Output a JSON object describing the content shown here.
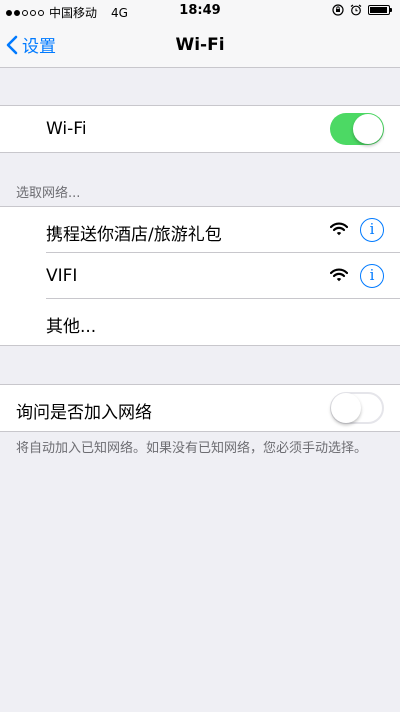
{
  "status_bar": {
    "carrier": "中国移动",
    "network": "4G",
    "time": "18:49"
  },
  "nav": {
    "back_label": "设置",
    "title": "Wi-Fi"
  },
  "wifi_toggle": {
    "label": "Wi-Fi",
    "on": true
  },
  "networks": {
    "header": "选取网络...",
    "items": [
      {
        "name": "携程送你酒店/旅游礼包"
      },
      {
        "name": "VIFI"
      }
    ],
    "other_label": "其他..."
  },
  "ask_to_join": {
    "label": "询问是否加入网络",
    "on": false,
    "note": "将自动加入已知网络。如果没有已知网络，您必须手动选择。"
  },
  "icons": {
    "back": "chevron-left-icon",
    "wifi": "wifi-signal-icon",
    "info": "info-icon",
    "orientation_lock": "orientation-lock-icon",
    "alarm": "alarm-icon",
    "battery": "battery-icon"
  },
  "colors": {
    "accent": "#007aff",
    "toggle_on": "#4cd964",
    "background": "#efeff4"
  }
}
